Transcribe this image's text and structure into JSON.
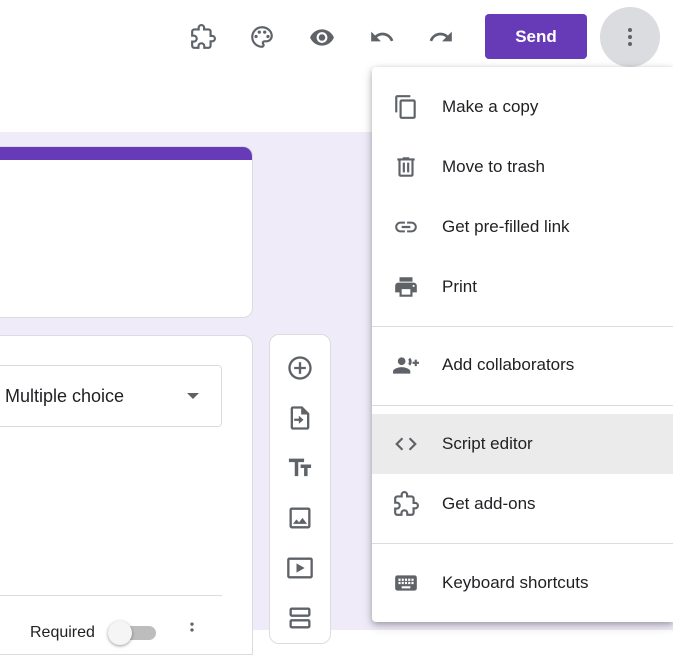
{
  "header": {
    "send_label": "Send",
    "icons": [
      "addon-icon",
      "palette-icon",
      "preview-icon",
      "undo-icon",
      "redo-icon",
      "more-vert-icon"
    ]
  },
  "colors": {
    "accent": "#673ab7",
    "canvas_bg": "#efebf8",
    "menu_active_bg": "#ebebeb",
    "icon": "#5f6368"
  },
  "question": {
    "type_selected": "Multiple choice",
    "required_label": "Required"
  },
  "toolbar": {
    "tools": [
      "add-question-icon",
      "import-questions-icon",
      "add-title-icon",
      "add-image-icon",
      "add-video-icon",
      "add-section-icon"
    ]
  },
  "menu": {
    "items": [
      {
        "label": "Make a copy",
        "icon": "copy-icon"
      },
      {
        "label": "Move to trash",
        "icon": "trash-icon"
      },
      {
        "label": "Get pre-filled link",
        "icon": "link-icon"
      },
      {
        "label": "Print",
        "icon": "print-icon"
      },
      {
        "label": "Add collaborators",
        "icon": "add-people-icon"
      },
      {
        "label": "Script editor",
        "icon": "code-icon",
        "active": true
      },
      {
        "label": "Get add-ons",
        "icon": "addon-icon"
      },
      {
        "label": "Keyboard shortcuts",
        "icon": "keyboard-icon"
      }
    ]
  }
}
